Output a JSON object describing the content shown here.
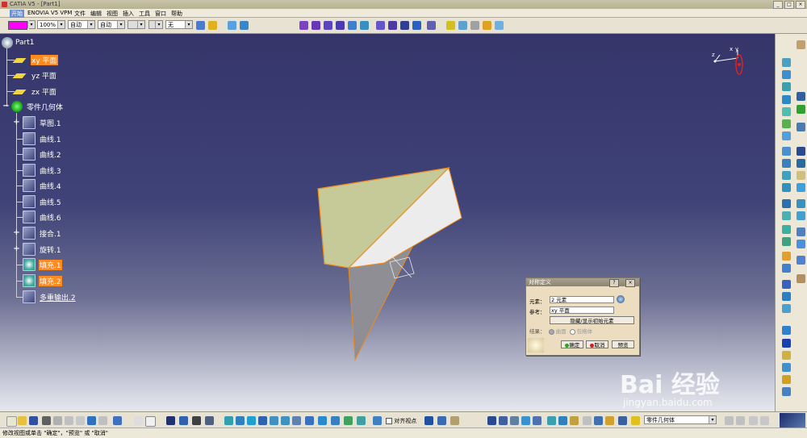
{
  "window": {
    "title": "CATIA V5 - [Part1]",
    "controls": [
      "_",
      "□",
      "×"
    ]
  },
  "menu": {
    "start": "开始",
    "items": [
      "ENOVIA V5 VPM",
      "文件",
      "编辑",
      "视图",
      "插入",
      "工具",
      "窗口",
      "帮助"
    ]
  },
  "toolbar": {
    "zoom": "100%",
    "combo_auto1": "自动",
    "combo_auto2": "自动",
    "combo_layer": "无",
    "swatch_color": "#ff00ff"
  },
  "tree": {
    "root": "Part1",
    "planes": [
      "xy 平面",
      "yz 平面",
      "zx 平面"
    ],
    "body": "零件几何体",
    "features": [
      "草图.1",
      "曲线.1",
      "曲线.2",
      "曲线.3",
      "曲线.4",
      "曲线.5",
      "曲线.6",
      "接合.1",
      "旋转.1",
      "填充.1",
      "填充.2",
      "多重输出.2"
    ]
  },
  "compass": {
    "x": "x",
    "y": "y",
    "z": "z"
  },
  "dialog": {
    "title": "对称定义",
    "help": "?",
    "close": "×",
    "element_label": "元素：",
    "element_value": "2 元素",
    "reference_label": "参考：",
    "reference_value": "xy 平面",
    "toggle_button": "隐藏/显示初始元素",
    "result_label": "结果：",
    "result_option1": "曲面",
    "result_option2": "包络体",
    "ok": "确定",
    "cancel": "取消",
    "preview": "预览"
  },
  "bottom": {
    "align_label": "对齐视点",
    "body_combo": "零件几何体"
  },
  "status": "修改视图或单击 \"确定\"，\"预览\" 或 \"取消\"",
  "watermark": {
    "brand": "Bai 经验",
    "url": "jingyan.baidu.com"
  },
  "colors": {
    "viewport_top": "#35356a",
    "highlight": "#ff8a1e",
    "surface_green": "#c6ca98",
    "edge_orange": "#f08a18"
  }
}
